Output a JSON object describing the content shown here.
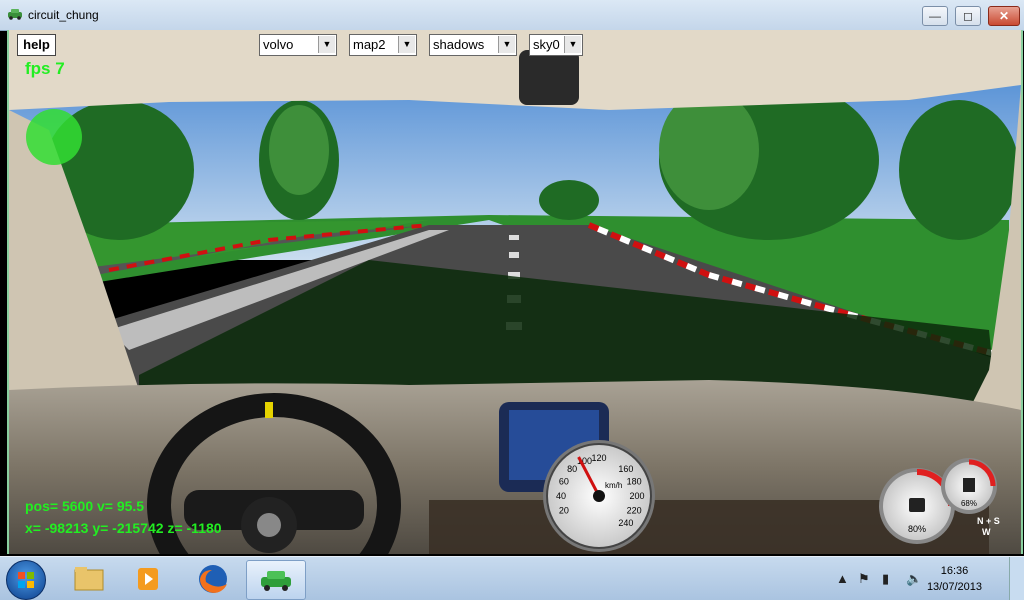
{
  "window": {
    "title": "circuit_chung",
    "minimize_icon": "minimize-icon",
    "maximize_icon": "maximize-icon",
    "close_icon": "close-icon"
  },
  "toolbar": {
    "help_label": "help",
    "car_select": "volvo",
    "map_select": "map2",
    "shadows_select": "shadows",
    "sky_select": "sky0"
  },
  "hud": {
    "fps": "fps 7",
    "line1": "pos= 5600  v= 95.5",
    "line2": "x= -98213  y= -215742  z= -1180"
  },
  "speedometer": {
    "unit": "km/h",
    "ticks": [
      "20",
      "40",
      "60",
      "80",
      "100",
      "120",
      "160",
      "180",
      "200",
      "220",
      "240"
    ],
    "needle_kmh": 95.5
  },
  "gauges": {
    "fuel_percent": "80%",
    "second_percent": "68%",
    "compass_letters": [
      "N",
      "S",
      "W"
    ]
  },
  "taskbar": {
    "items": [
      "explorer-icon",
      "media-player-icon",
      "firefox-icon",
      "circuit-chung-icon"
    ],
    "tray_icons": [
      "show-hidden-icon",
      "flag-icon",
      "network-icon",
      "volume-icon"
    ],
    "time": "16:36",
    "date": "13/07/2013"
  },
  "colors": {
    "hud_text": "#22ee22",
    "grass": "#2a8a2a",
    "asphalt": "#4a4a4a",
    "sky_top": "#3b7fd0",
    "curb_red": "#d01010"
  }
}
